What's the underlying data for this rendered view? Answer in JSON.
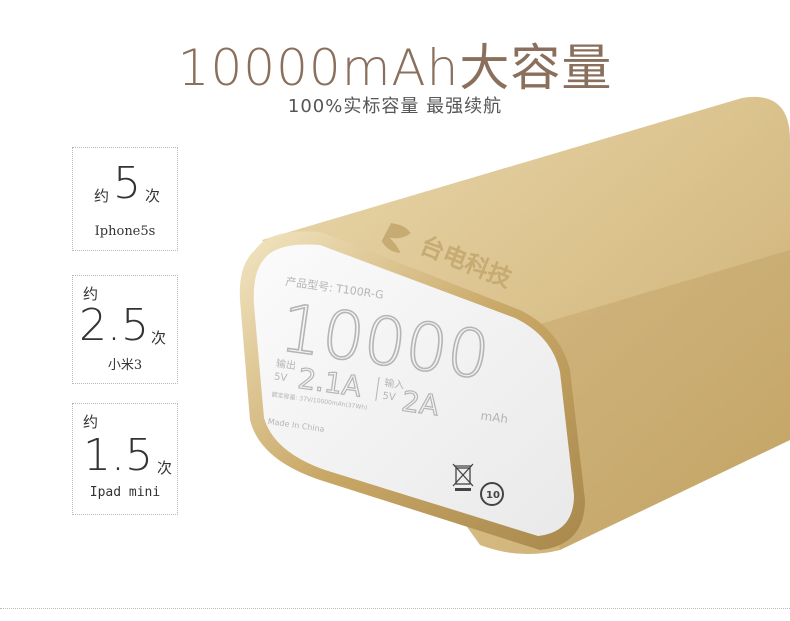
{
  "header": {
    "title": "10000mAh大容量",
    "subtitle": "100%实标容量  最强续航"
  },
  "cards": [
    {
      "prefix": "约",
      "number": "5",
      "suffix": "次",
      "device": "Iphone5s"
    },
    {
      "prefix": "约",
      "number": "2.5",
      "suffix": "次",
      "device": "小米3"
    },
    {
      "prefix": "约",
      "number": "1.5",
      "suffix": "次",
      "device": "Ipad mini"
    }
  ],
  "product": {
    "brand": "台电科技",
    "model": "产品型号: T100R-G",
    "capacity": "10000",
    "capacity_unit": "mAh",
    "output_label": "输出",
    "output_voltage": "5V",
    "output_current": "2.1A",
    "input_label": "输入",
    "input_voltage": "5V",
    "input_current": "2A",
    "rated": "额定容量: 37V/10000mAh(37Wh)",
    "origin": "Made In China",
    "recycle_mark": "10"
  },
  "colors": {
    "headline": "#8a6f5c",
    "gold_light": "#e2ce9f",
    "gold_dark": "#b8995c",
    "label_face": "#f2f2f2"
  }
}
